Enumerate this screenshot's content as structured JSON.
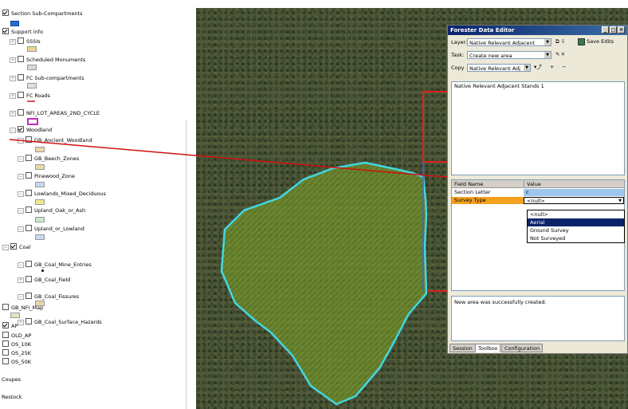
{
  "toc": {
    "items": [
      {
        "label": "Section Sub-Compartments",
        "checked": true,
        "expander": "",
        "swatch": "#1f6fd0",
        "swatch_fill": true
      },
      {
        "label": "Support info",
        "checked": true,
        "expander": "",
        "swatch": "",
        "swatch_fill": false
      },
      {
        "label": "SSSIs",
        "checked": false,
        "expander": "⊞",
        "swatch": "#e8d68a",
        "swatch_fill": false
      },
      {
        "label": "Scheduled Monuments",
        "checked": false,
        "expander": "⊞",
        "swatch": "#d8d8d8",
        "swatch_fill": false
      },
      {
        "label": "FC Sub-compartments",
        "checked": false,
        "expander": "⊞",
        "swatch": "#e0e0e0",
        "swatch_fill": false
      },
      {
        "label": "FC Roads",
        "checked": false,
        "expander": "⊞",
        "swatch": "#e05050",
        "swatch_fill": false
      },
      {
        "label": "NFI_LOT_AREAS_2ND_CYCLE",
        "checked": false,
        "expander": "⊞",
        "swatch": "#c02cc0",
        "swatch_fill": false
      },
      {
        "label": "Woodland",
        "checked": true,
        "expander": "⊟",
        "swatch": "",
        "swatch_fill": false
      },
      {
        "label": "GB_Ancient_Woodland",
        "checked": false,
        "expander": "⊟",
        "swatch": "#e8d8a8",
        "swatch_fill": false
      },
      {
        "label": "GB_Beech_Zones",
        "checked": false,
        "expander": "⊟",
        "swatch": "#e8d8a8",
        "swatch_fill": false
      },
      {
        "label": "Pinewood_Zone",
        "checked": false,
        "expander": "⊟",
        "swatch": "#c8d8f0",
        "swatch_fill": false
      },
      {
        "label": "Lowlands_Mixed_Deciduous",
        "checked": false,
        "expander": "⊟",
        "swatch": "#f0e890",
        "swatch_fill": false
      },
      {
        "label": "Upland_Oak_or_Ash",
        "checked": false,
        "expander": "⊟",
        "swatch": "#c8e8c8",
        "swatch_fill": false
      },
      {
        "label": "Upland_or_Lowland",
        "checked": false,
        "expander": "⊟",
        "swatch": "#c8d8f0",
        "swatch_fill": false
      },
      {
        "label": "Coal",
        "checked": true,
        "expander": "⊟",
        "swatch": "",
        "swatch_fill": false
      },
      {
        "label": "GB_Coal_Mine_Entries",
        "checked": false,
        "expander": "⊟",
        "swatch": "",
        "swatch_fill": false
      },
      {
        "label": "GB_Coal_Field",
        "checked": false,
        "expander": "⊞",
        "swatch": "",
        "swatch_fill": false
      },
      {
        "label": "GB_Coal_Fissures",
        "checked": false,
        "expander": "⊟",
        "swatch": "#e8d8a8",
        "swatch_fill": false
      },
      {
        "label": "GB_Coal_Surface_Hazards",
        "checked": false,
        "expander": "⊞",
        "swatch": "",
        "swatch_fill": false
      },
      {
        "label": "GB_NFI_Map",
        "checked": false,
        "expander": "",
        "swatch": "#e8e0c0",
        "swatch_fill": false
      },
      {
        "label": "AP",
        "checked": true,
        "expander": "",
        "swatch": "",
        "swatch_fill": false
      },
      {
        "label": "OLD_AP",
        "checked": false,
        "expander": "",
        "swatch": "",
        "swatch_fill": false
      },
      {
        "label": "OS_10K",
        "checked": false,
        "expander": "",
        "swatch": "",
        "swatch_fill": false
      },
      {
        "label": "OS_25K",
        "checked": false,
        "expander": "",
        "swatch": "",
        "swatch_fill": false
      },
      {
        "label": "OS_50K",
        "checked": false,
        "expander": "",
        "swatch": "",
        "swatch_fill": false
      }
    ],
    "coupes_label": "Coupes",
    "restock_label": "Restock"
  },
  "editor": {
    "title": "Forester Data Editor",
    "layer_label": "Layer:",
    "layer_value": "Native Relevant Adjacent",
    "save_edits_label": "Save Edits",
    "task_label": "Task:",
    "task_value": "Create new area",
    "copy_label": "Copy",
    "copy_value": "Native Relevant Adj",
    "plus_label": "+",
    "minus_label": "−",
    "stands_item": "Native Relevant Adjacent Stands 1",
    "grid_header_field": "Field Name",
    "grid_header_value": "Value",
    "rows": [
      {
        "field": "Section Letter",
        "value": "c"
      },
      {
        "field": "Survey Type",
        "value": "<null>"
      }
    ],
    "dropdown_options": [
      "<null>",
      "Aerial",
      "Ground Survey",
      "Not Surveyed"
    ],
    "dropdown_selected": "Aerial",
    "status_message": "New area was successfully created.",
    "tabs": [
      "Session",
      "Toolbox",
      "Configuration"
    ],
    "colors": {
      "title_bar": "#0a246a",
      "selected_row": "#f4a020",
      "value_highlight": "#9cc8f0",
      "dropdown_selection": "#0a246a"
    }
  },
  "map": {
    "polygon_outline": "#40d8e8",
    "polygon_fill": "#6a8a2a",
    "frame_outline": "#e02020",
    "arrow_color": "#d01010"
  }
}
